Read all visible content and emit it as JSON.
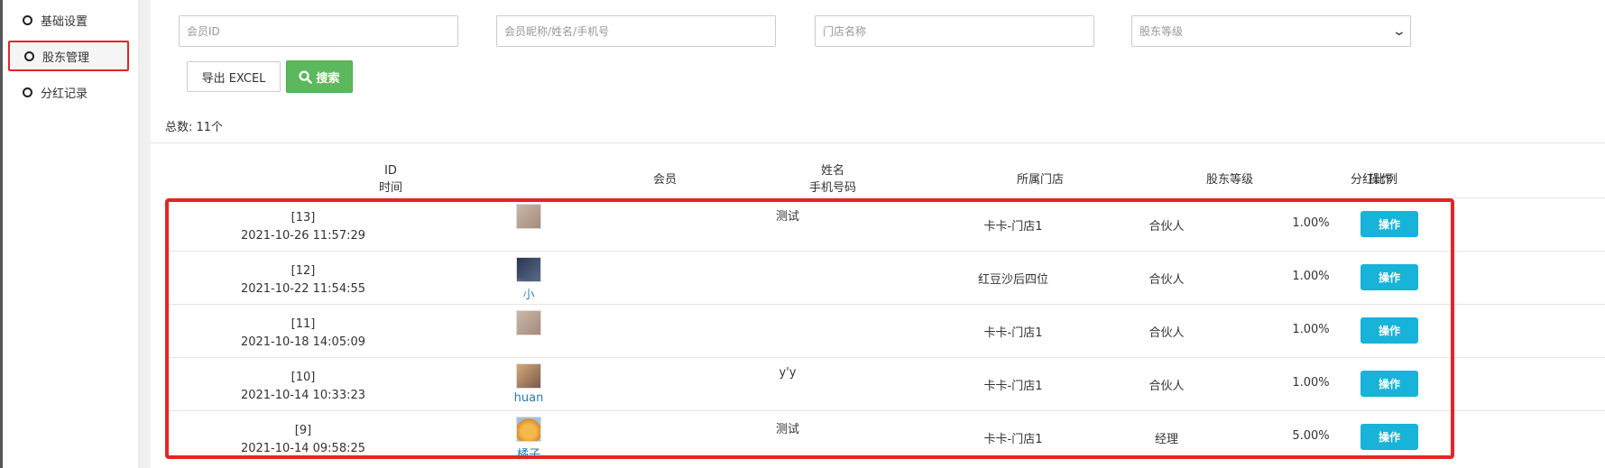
{
  "sidebar": {
    "items": [
      {
        "label": "基础设置"
      },
      {
        "label": "股东管理"
      },
      {
        "label": "分红记录"
      }
    ]
  },
  "filters": {
    "member_id": {
      "placeholder": "会员ID"
    },
    "nickname": {
      "placeholder": "会员昵称/姓名/手机号"
    },
    "store": {
      "placeholder": "门店名称"
    },
    "level": {
      "selected": "股东等级"
    }
  },
  "toolbar": {
    "export_label": "导出 EXCEL",
    "search_label": "搜索"
  },
  "summary": {
    "total_text": "总数: 11个"
  },
  "table": {
    "headers": {
      "id": "ID",
      "time": "时间",
      "member": "会员",
      "name": "姓名",
      "phone": "手机号码",
      "store": "所属门店",
      "level": "股东等级",
      "ratio": "分红比例",
      "action": "操作"
    },
    "rows": [
      {
        "id": "[13]",
        "time": "2021-10-26 11:57:29",
        "member": "",
        "name": "测试",
        "store": "卡卡-门店1",
        "level": "合伙人",
        "ratio": "1.00%",
        "action": "操作"
      },
      {
        "id": "[12]",
        "time": "2021-10-22 11:54:55",
        "member": "小",
        "name": "",
        "store": "红豆沙后四位",
        "level": "合伙人",
        "ratio": "1.00%",
        "action": "操作"
      },
      {
        "id": "[11]",
        "time": "2021-10-18 14:05:09",
        "member": "",
        "name": "",
        "store": "卡卡-门店1",
        "level": "合伙人",
        "ratio": "1.00%",
        "action": "操作"
      },
      {
        "id": "[10]",
        "time": "2021-10-14 10:33:23",
        "member": "huan",
        "name": "y'y",
        "store": "卡卡-门店1",
        "level": "合伙人",
        "ratio": "1.00%",
        "action": "操作"
      },
      {
        "id": "[9]",
        "time": "2021-10-14 09:58:25",
        "member": "橘子",
        "name": "测试",
        "store": "卡卡-门店1",
        "level": "经理",
        "ratio": "5.00%",
        "action": "操作"
      }
    ]
  },
  "colors": {
    "highlight": "#e52424",
    "search_button": "#5cb85c",
    "action_button": "#17b3d8",
    "member_link": "#2a7ab0"
  },
  "icons": {
    "sidebar_bullet": "circle-outline-icon",
    "search": "search-icon",
    "select": "chevron-down-icon"
  }
}
